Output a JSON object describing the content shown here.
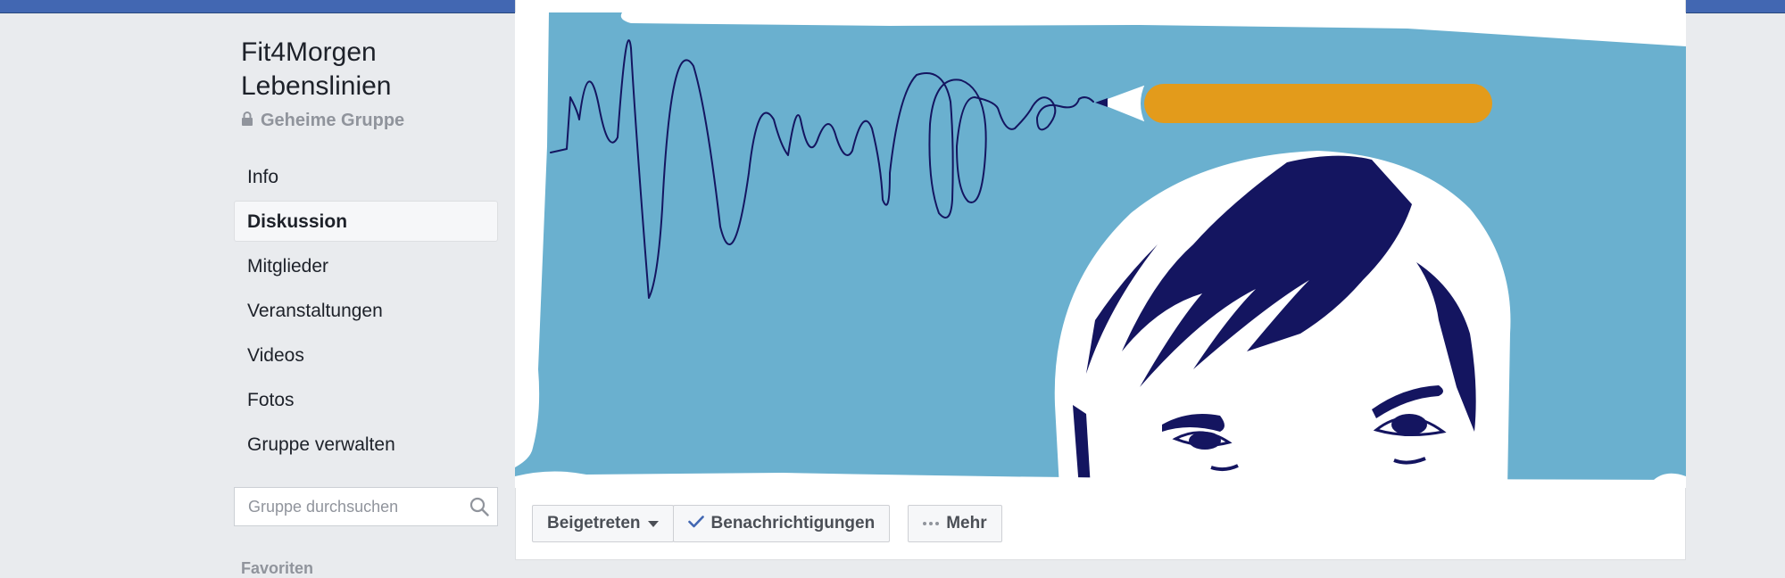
{
  "group": {
    "name_line1": "Fit4Morgen",
    "name_line2": "Lebenslinien",
    "privacy": "Geheime Gruppe"
  },
  "nav": {
    "items": [
      {
        "label": "Info"
      },
      {
        "label": "Diskussion",
        "active": true
      },
      {
        "label": "Mitglieder"
      },
      {
        "label": "Veranstaltungen"
      },
      {
        "label": "Videos"
      },
      {
        "label": "Fotos"
      },
      {
        "label": "Gruppe verwalten"
      }
    ]
  },
  "search": {
    "placeholder": "Gruppe durchsuchen",
    "value": ""
  },
  "sidebar_section": {
    "favorites_label": "Favoriten"
  },
  "actions": {
    "joined_label": "Beigetreten",
    "notifications_label": "Benachrichtigungen",
    "more_label": "Mehr"
  },
  "colors": {
    "topbar": "#4267b2",
    "cover_sky": "#6ab0cf",
    "ink": "#141560",
    "pencil": "#e39b1b",
    "check": "#4267b2"
  },
  "icons": {
    "privacy": "lock-icon",
    "search": "search-icon",
    "joined_dropdown": "caret-down-icon",
    "notifications": "checkmark-icon",
    "more": "more-dots-icon"
  }
}
